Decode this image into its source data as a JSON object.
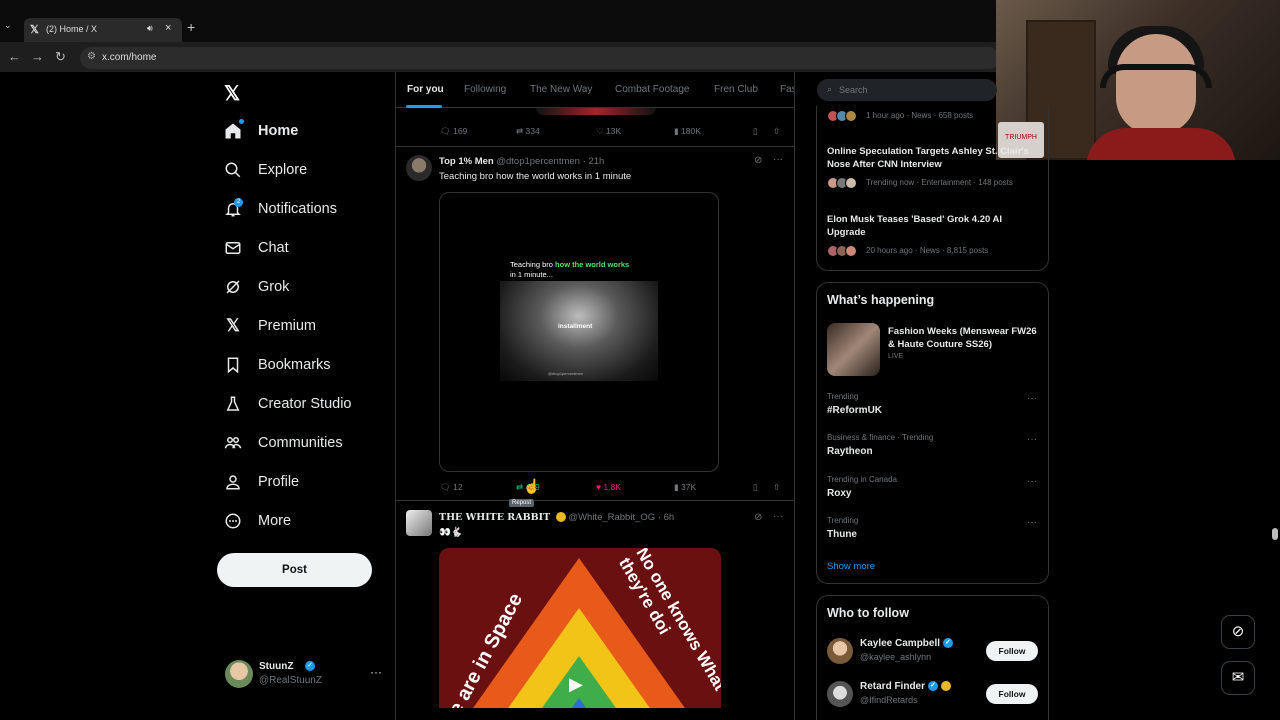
{
  "browser": {
    "tab_title": "(2) Home / X",
    "url": "x.com/home",
    "new_tab_label": "+",
    "tab_menu_label": "⌄"
  },
  "webcam": {
    "prop_text": "TRIUMPH"
  },
  "nav": {
    "logo": "𝕏",
    "notification_count": "2",
    "items": [
      {
        "label": "Home",
        "icon": "home-icon",
        "active": true
      },
      {
        "label": "Explore",
        "icon": "search-icon"
      },
      {
        "label": "Notifications",
        "icon": "bell-icon"
      },
      {
        "label": "Chat",
        "icon": "mail-icon"
      },
      {
        "label": "Grok",
        "icon": "grok-icon"
      },
      {
        "label": "Premium",
        "icon": "x-icon"
      },
      {
        "label": "Bookmarks",
        "icon": "bookmark-icon"
      },
      {
        "label": "Creator Studio",
        "icon": "flask-icon"
      },
      {
        "label": "Communities",
        "icon": "people-icon"
      },
      {
        "label": "Profile",
        "icon": "person-icon"
      },
      {
        "label": "More",
        "icon": "more-circle-icon"
      }
    ],
    "post_button": "Post",
    "account": {
      "name": "StuunZ",
      "handle": "@RealStuunZ",
      "more": "···"
    }
  },
  "feed": {
    "tabs": [
      "For you",
      "Following",
      "The New Way",
      "Combat Footage",
      "Fren Club",
      "Fas"
    ],
    "prev_post_actions": {
      "replies": "169",
      "reposts": "334",
      "likes": "13K",
      "views": "180K"
    },
    "post1": {
      "name": "Top 1% Men",
      "handle": "@dtop1percentmen",
      "time": "· 21h",
      "text": "Teaching bro how the world works in 1 minute",
      "media_caption_prefix": "Teaching bro ",
      "media_caption_highlight": "how the world works",
      "media_caption_suffix": "in 1 minute...",
      "media_word": "installment",
      "media_credit": "@dtop1percentmen",
      "actions": {
        "replies": "12",
        "reposts": "419",
        "likes": "1.8K",
        "views": "37K"
      },
      "tooltip": "Repost"
    },
    "post2": {
      "name": "THE WHITE RABBIT",
      "handle": "@White_Rabbit_OG",
      "time": "· 6h",
      "text": "👀🐇",
      "media_text_left": "e are in Space",
      "media_text_right": "No one knows What they're doi"
    }
  },
  "sidebar": {
    "search_placeholder": "Search",
    "news": [
      {
        "title": "",
        "meta": "1 hour ago · News · 658 posts"
      },
      {
        "title": "Online Speculation Targets Ashley St. Clair's Nose After CNN Interview",
        "meta": "Trending now · Entertainment · 148 posts"
      },
      {
        "title": "Elon Musk Teases 'Based' Grok 4.20 AI Upgrade",
        "meta": "20 hours ago · News · 8,815 posts"
      }
    ],
    "whats_happening": {
      "heading": "What’s happening",
      "featured": {
        "title": "Fashion Weeks (Menswear FW26 & Haute Couture SS26)",
        "status": "LIVE"
      },
      "trends": [
        {
          "context": "Trending",
          "title": "#ReformUK"
        },
        {
          "context": "Business & finance · Trending",
          "title": "Raytheon"
        },
        {
          "context": "Trending in Canada",
          "title": "Roxy"
        },
        {
          "context": "Trending",
          "title": "Thune"
        }
      ],
      "show_more": "Show more"
    },
    "who_to_follow": {
      "heading": "Who to follow",
      "accounts": [
        {
          "name": "Kaylee Campbell",
          "handle": "@kaylee_ashlynn",
          "button": "Follow"
        },
        {
          "name": "Retard Finder",
          "handle": "@IfindRetards",
          "button": "Follow"
        }
      ]
    }
  },
  "colors": {
    "accent": "#1d9bf0",
    "like": "#f91880",
    "repost": "#00ba7c"
  }
}
